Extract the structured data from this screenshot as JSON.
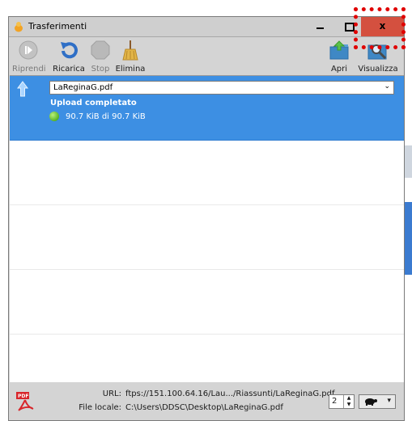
{
  "window": {
    "title": "Trasferimenti",
    "controls": {
      "minimize": "minimize",
      "maximize": "maximize",
      "close_label": "x"
    }
  },
  "toolbar": {
    "items": [
      {
        "label": "Riprendi",
        "icon": "play-icon",
        "enabled": false
      },
      {
        "label": "Ricarica",
        "icon": "reload-icon",
        "enabled": true
      },
      {
        "label": "Stop",
        "icon": "stop-icon",
        "enabled": false
      },
      {
        "label": "Elimina",
        "icon": "broom-icon",
        "enabled": true
      },
      {
        "label": "Apri",
        "icon": "folder-open-icon",
        "enabled": true
      },
      {
        "label": "Visualizza",
        "icon": "magnifier-icon",
        "enabled": true
      }
    ]
  },
  "transfers": [
    {
      "direction": "upload",
      "filename": "LaReginaG.pdf",
      "status": "Upload completato",
      "progress_text": "90.7 KiB di 90.7 KiB",
      "selected": true
    }
  ],
  "footer": {
    "url_label": "URL:",
    "url_value": "ftps://151.100.64.16/Lau.../Riassunti/LaReginaG.pdf",
    "local_label": "File locale:",
    "local_value": "C:\\Users\\DDSC\\Desktop\\LaReginaG.pdf",
    "connections": "2",
    "speed_icon": "turtle-icon"
  },
  "colors": {
    "selection": "#3d8fe3",
    "close_button": "#d4503f",
    "highlight_box": "#e00000"
  }
}
